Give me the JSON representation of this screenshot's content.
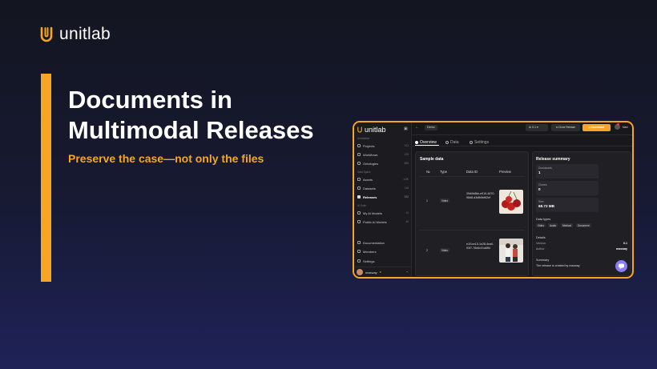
{
  "brand": {
    "name": "unitlab",
    "accent": "#f6a623"
  },
  "hero": {
    "title": "Documents in Multimodal Releases",
    "subtitle": "Preserve the case—not only the files"
  },
  "app": {
    "logo_text": "unitlab",
    "sidebar": {
      "sections": [
        "Annotation",
        "Data Space",
        "AI Suite"
      ],
      "annotation_items": [
        {
          "label": "Projects",
          "count": "101"
        },
        {
          "label": "Workflows",
          "count": "120"
        },
        {
          "label": "Ontologies",
          "count": "863"
        }
      ],
      "data_items": [
        {
          "label": "Assets",
          "count": "4.8K"
        },
        {
          "label": "Datasets",
          "count": "116"
        },
        {
          "label": "Releases",
          "count": "322"
        }
      ],
      "ai_items": [
        {
          "label": "My AI Models",
          "count": "10"
        },
        {
          "label": "Public AI Models",
          "count": "40"
        }
      ],
      "bottom_items": [
        "Documentation",
        "Members",
        "Settings"
      ],
      "user": "maxway"
    },
    "topbar": {
      "back_icon": "arrow-left-icon",
      "breadcrumb": "Demo",
      "version": "0.1",
      "clone": "Clone Release",
      "download": "Download",
      "user": "Maxi"
    },
    "tabs": [
      "Overview",
      "Data",
      "Settings"
    ],
    "sample": {
      "title": "Sample data",
      "headers": [
        "№",
        "Type",
        "Data ID",
        "Preview"
      ],
      "rows": [
        {
          "num": "1",
          "type": "Video",
          "data_id": "39d0b86e-e919-4670-98d8-d3dfb5bf62ef"
        },
        {
          "num": "2",
          "type": "Video",
          "data_id": "e1f1ce15-1e28-4ea0-93f7-76e6c01a6ff4"
        }
      ]
    },
    "summary": {
      "title": "Release summary",
      "cards": [
        {
          "label": "Downloads",
          "value": "1"
        },
        {
          "label": "Clones",
          "value": "0"
        },
        {
          "label": "Size",
          "value": "68.72 MB"
        }
      ],
      "data_types_label": "Data types",
      "data_types": [
        "Video",
        "Audio",
        "Medical",
        "Document"
      ],
      "details_label": "Details",
      "details": [
        {
          "key": "Version",
          "value": "0.1"
        },
        {
          "key": "Author",
          "value": "maxway"
        }
      ],
      "summary_label": "Summary",
      "summary_text": "The release is created by maxway"
    }
  }
}
